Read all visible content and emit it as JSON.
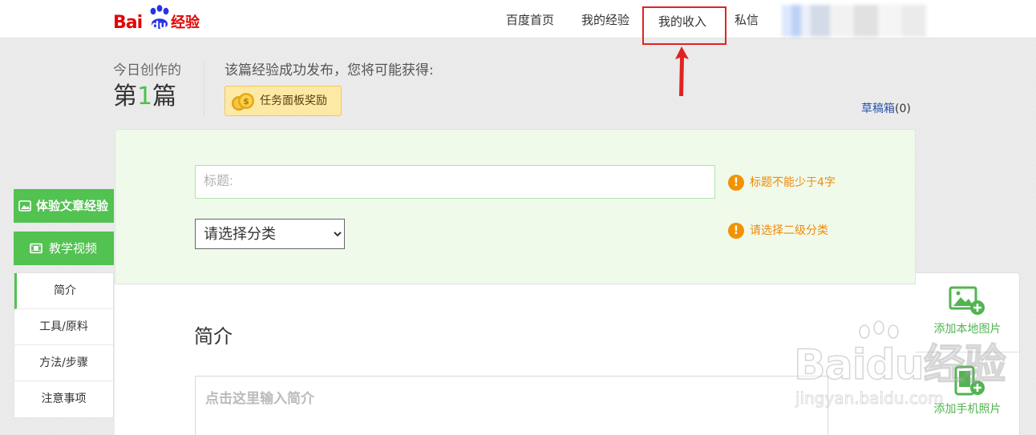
{
  "header": {
    "logo_text_bai": "Bai",
    "logo_text_du": "du",
    "logo_text_jingyan": "经验",
    "nav": [
      {
        "label": "百度首页"
      },
      {
        "label": "我的经验"
      },
      {
        "label": "我的收入"
      },
      {
        "label": "私信"
      }
    ],
    "highlighted_nav": "我的收入"
  },
  "stats": {
    "today_label": "今日创作的",
    "today_prefix": "第",
    "today_count": "1",
    "today_suffix": "篇",
    "reward_title": "该篇经验成功发布，您将可能获得:",
    "reward_badge": "任务面板奖励"
  },
  "drafts": {
    "label": "草稿箱",
    "count": "(0)"
  },
  "form": {
    "title_placeholder": "标题:",
    "title_value": "",
    "category_selected": "请选择分类",
    "hint_title": "标题不能少于4字",
    "hint_category": "请选择二级分类",
    "warn_glyph": "!"
  },
  "content": {
    "section_heading": "简介",
    "intro_placeholder": "点击这里输入简介"
  },
  "sidebar": {
    "buttons": [
      {
        "label": "体验文章经验"
      },
      {
        "label": "教学视频"
      }
    ],
    "nav": [
      {
        "label": "简介"
      },
      {
        "label": "工具/原料"
      },
      {
        "label": "方法/步骤"
      },
      {
        "label": "注意事项"
      }
    ]
  },
  "media": {
    "add_local": "添加本地图片",
    "add_phone": "添加手机照片"
  },
  "watermark": {
    "main": "Baidu经验",
    "url": "jingyan.baidu.com"
  },
  "colors": {
    "brand_red": "#e10602",
    "accent_green": "#52c251",
    "warning_orange": "#f08a0a",
    "link_blue": "#2a55a6",
    "annotation_red": "#e22222"
  }
}
